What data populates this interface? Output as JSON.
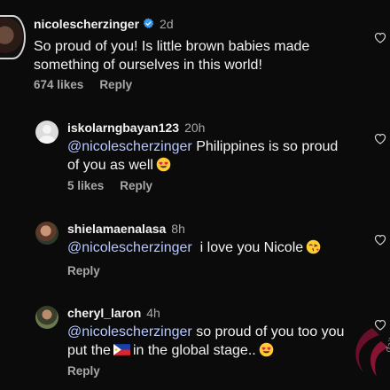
{
  "comments": [
    {
      "username": "nicolescherzinger",
      "verified": true,
      "time": "2d",
      "text": "So proud of you! Is little brown babies made something of ourselves in this world!",
      "likes": "674 likes",
      "reply_label": "Reply",
      "avatar": "profile-photo"
    },
    {
      "username": "iskolarngbayan123",
      "time": "20h",
      "mention": "@nicolescherzinger",
      "text": "Philippines is so proud of you as well",
      "emoji": "heart-eyes-emoji",
      "likes": "5 likes",
      "reply_label": "Reply",
      "avatar": "default-avatar"
    },
    {
      "username": "shielamaenalasa",
      "time": "8h",
      "mention": "@nicolescherzinger",
      "text": "i love you Nicole",
      "emoji": "kissing-heart-emoji",
      "reply_label": "Reply",
      "avatar": "profile-photo"
    },
    {
      "username": "cheryl_laron",
      "time": "4h",
      "mention": "@nicolescherzinger",
      "text_part1": "so proud of you too you put the",
      "flag": "philippines-flag",
      "text_part2": "in the global stage..",
      "emoji": "heart-eyes-emoji",
      "reply_label": "Reply",
      "avatar": "profile-photo"
    }
  ],
  "colors": {
    "background": "#0b0b0b",
    "text": "#f2f2f2",
    "secondary": "#a8a8a8",
    "mention": "#b7c8ff",
    "verified": "#3897f0"
  },
  "watermark": {
    "text": "dailypedia",
    "icon": "watermark-logo"
  }
}
